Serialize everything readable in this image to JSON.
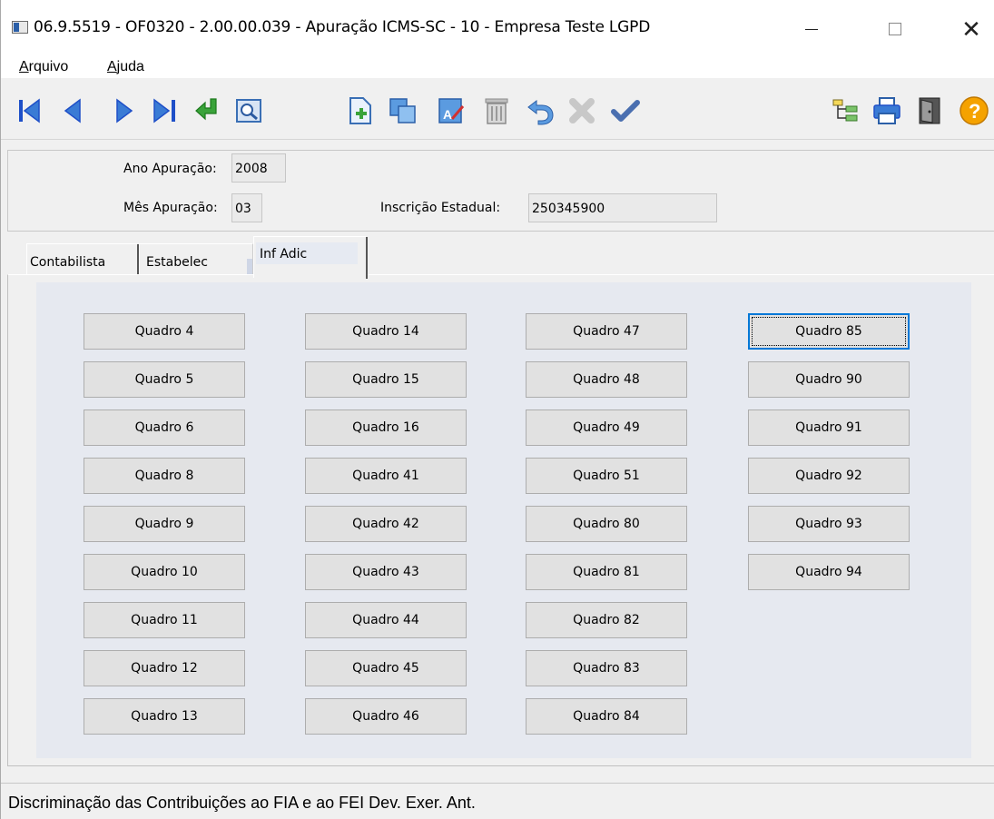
{
  "window": {
    "title": "06.9.5519 - OF0320 - 2.00.00.039 - Apuração ICMS-SC - 10 - Empresa Teste LGPD",
    "close_glyph": "✕"
  },
  "menu": {
    "arquivo_first": "A",
    "arquivo_rest": "rquivo",
    "ajuda_first": "A",
    "ajuda_rest": "juda"
  },
  "toolbar": {
    "icons": [
      "first-record-icon",
      "prev-record-icon",
      "next-record-icon",
      "last-record-icon",
      "return-icon",
      "preview-icon",
      "new-icon",
      "copy-icon",
      "edit-icon",
      "delete-icon",
      "undo-icon",
      "cancel-icon",
      "confirm-icon",
      "tree-icon",
      "print-icon",
      "exit-icon",
      "help-icon"
    ],
    "help_glyph": "?"
  },
  "header": {
    "ano_label": "Ano Apuração:",
    "ano_value": "2008",
    "mes_label": "Mês Apuração:",
    "mes_value": "03",
    "ie_label": "Inscrição Estadual:",
    "ie_value": "250345900"
  },
  "tabs": [
    {
      "label": "Contabilista"
    },
    {
      "label": "Estabelec"
    },
    {
      "label": "Inf Adic",
      "active": true
    }
  ],
  "quadros": {
    "col1": [
      "Quadro 4",
      "Quadro 5",
      "Quadro 6",
      "Quadro 8",
      "Quadro 9",
      "Quadro 10",
      "Quadro 11",
      "Quadro 12",
      "Quadro 13"
    ],
    "col2": [
      "Quadro 14",
      "Quadro 15",
      "Quadro 16",
      "Quadro 41",
      "Quadro 42",
      "Quadro 43",
      "Quadro 44",
      "Quadro 45",
      "Quadro 46"
    ],
    "col3": [
      "Quadro 47",
      "Quadro 48",
      "Quadro 49",
      "Quadro 51",
      "Quadro 80",
      "Quadro 81",
      "Quadro 82",
      "Quadro 83",
      "Quadro 84"
    ],
    "col4": [
      "Quadro 85",
      "Quadro 90",
      "Quadro 91",
      "Quadro 92",
      "Quadro 93",
      "Quadro 94"
    ]
  },
  "status": {
    "text": "Discriminação das Contribuições ao FIA e ao FEI Dev. Exer. Ant."
  },
  "colors": {
    "nav_blue": "#1e4fc8",
    "toolbar_blue": "#3a7bd5",
    "confirm_blue": "#4a6fb0",
    "return_green": "#3aa33a",
    "help_orange": "#f5a200",
    "focus_blue": "#0078d7"
  }
}
